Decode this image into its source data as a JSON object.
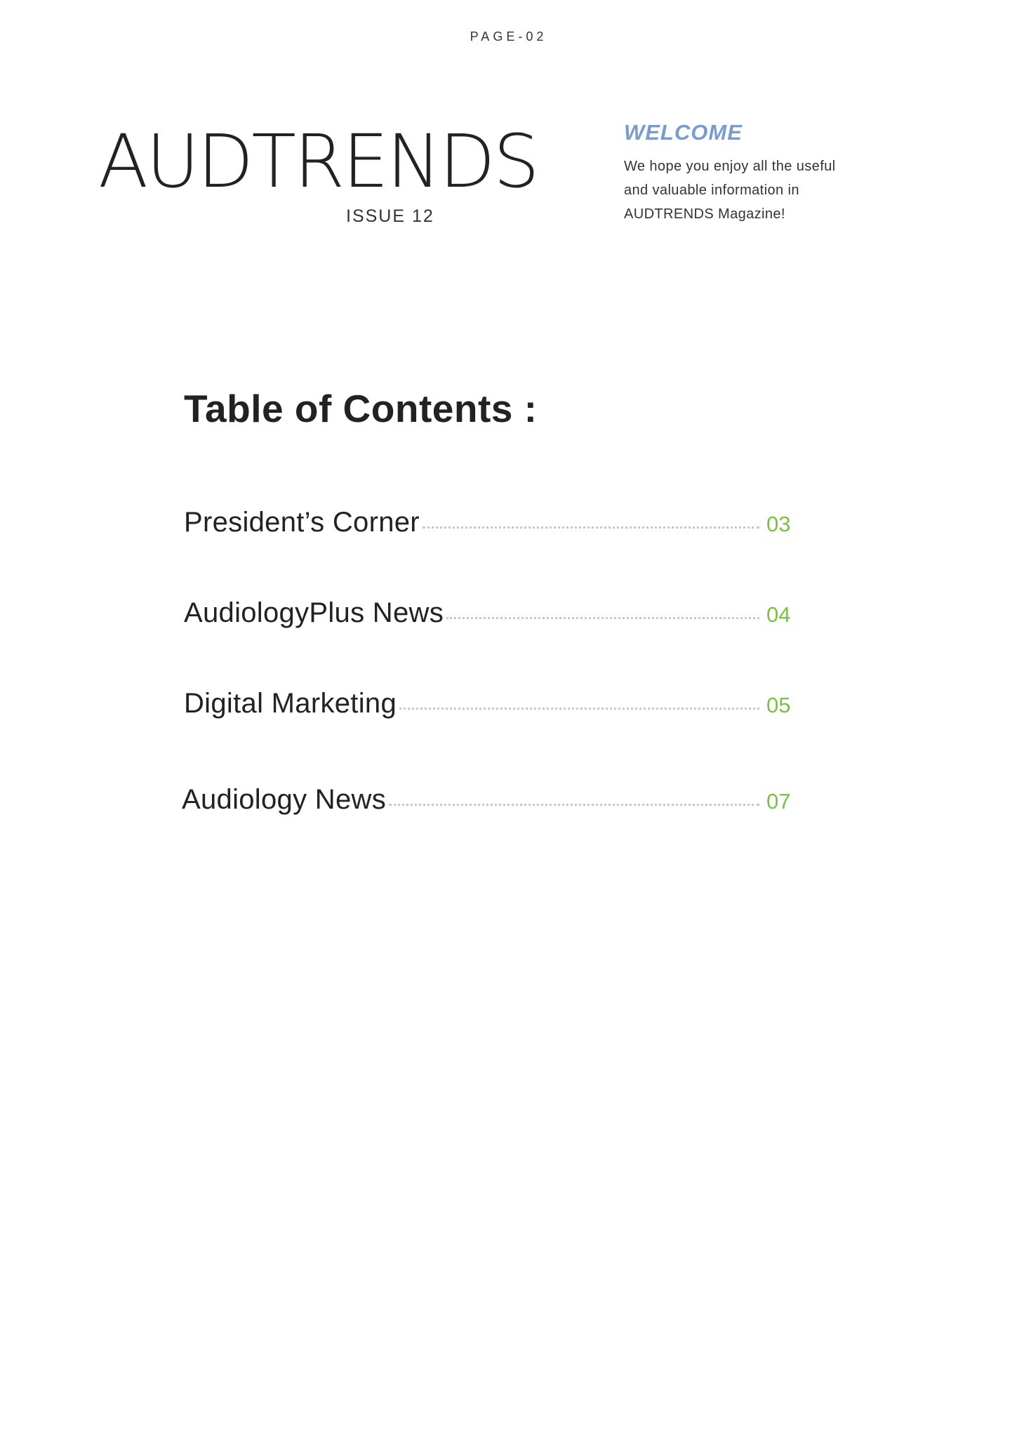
{
  "page_label": "PAGE-02",
  "masthead": {
    "brand": "AUDTRENDS",
    "issue": "ISSUE 12"
  },
  "welcome": {
    "title": "WELCOME",
    "lines": [
      "We hope you enjoy all the useful",
      "and valuable information in",
      "AUDTRENDS Magazine!"
    ]
  },
  "toc": {
    "title": "Table of Contents :",
    "items": [
      {
        "label": "President’s  Corner",
        "page": "03"
      },
      {
        "label": "AudiologyPlus News",
        "page": "04"
      },
      {
        "label": "Digital Marketing",
        "page": "05"
      },
      {
        "label": "Audiology News",
        "page": "07"
      }
    ]
  },
  "colors": {
    "accent_blue": "#7a9ccc",
    "accent_green": "#7ac143",
    "text": "#222222"
  }
}
